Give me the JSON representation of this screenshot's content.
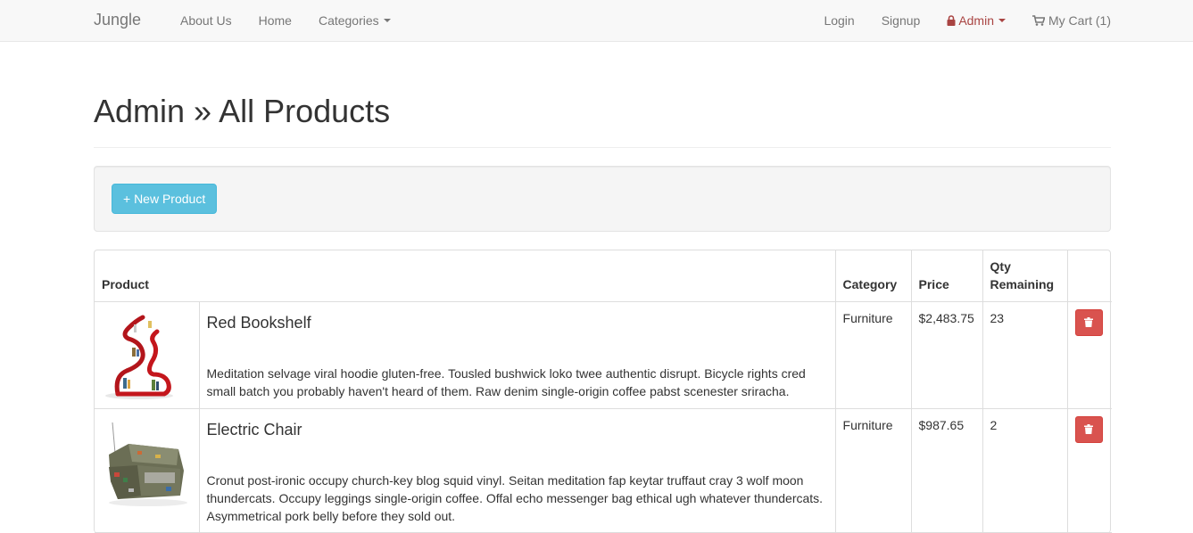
{
  "navbar": {
    "brand": "Jungle",
    "left_links": [
      "About Us",
      "Home",
      "Categories"
    ],
    "login": "Login",
    "signup": "Signup",
    "admin": "Admin",
    "cart": "My Cart (1)",
    "admin_color": "#a94442"
  },
  "page": {
    "title": "Admin » All Products"
  },
  "toolbar": {
    "new_product_label": "+ New Product"
  },
  "table": {
    "headers": {
      "product": "Product",
      "category": "Category",
      "price": "Price",
      "qty": "Qty Remaining"
    },
    "rows": [
      {
        "name": "Red Bookshelf",
        "description": "Meditation selvage viral hoodie gluten-free. Tousled bushwick loko twee authentic disrupt. Bicycle rights cred small batch you probably haven't heard of them. Raw denim single-origin coffee pabst scenester sriracha.",
        "category": "Furniture",
        "price": "$2,483.75",
        "qty": "23",
        "image_icon": "red-bookshelf-image"
      },
      {
        "name": "Electric Chair",
        "description": "Cronut post-ironic occupy church-key blog squid vinyl. Seitan meditation fap keytar truffaut cray 3 wolf moon thundercats. Occupy leggings single-origin coffee. Offal echo messenger bag ethical ugh whatever thundercats. Asymmetrical pork belly before they sold out.",
        "category": "Furniture",
        "price": "$987.65",
        "qty": "2",
        "image_icon": "electric-chair-image"
      }
    ]
  },
  "colors": {
    "info_button": "#5bc0de",
    "danger_button": "#d9534f"
  }
}
